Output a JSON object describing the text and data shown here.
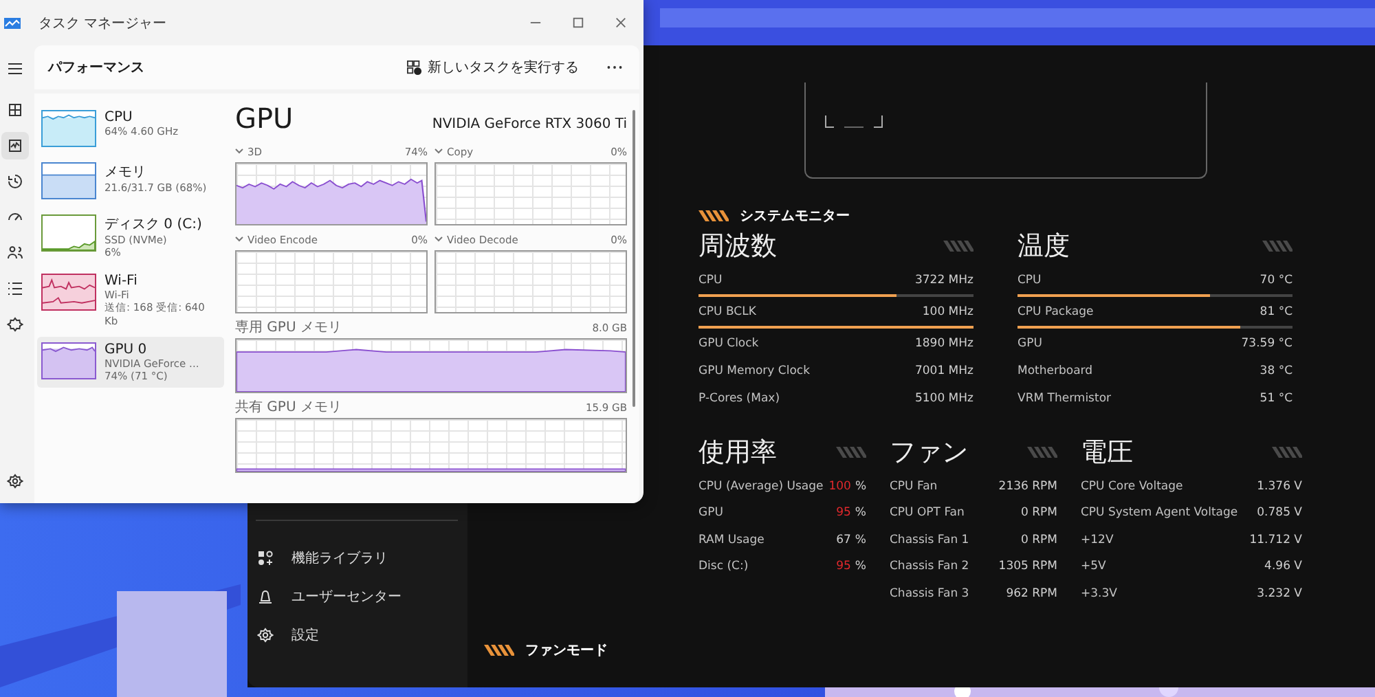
{
  "task_manager": {
    "title": "タスク マネージャー",
    "section": "パフォーマンス",
    "run_task": "新しいタスクを実行する",
    "rail": [
      {
        "kind": "processes",
        "selected": false
      },
      {
        "kind": "performance",
        "selected": true
      },
      {
        "kind": "history",
        "selected": false
      },
      {
        "kind": "startup",
        "selected": false
      },
      {
        "kind": "users",
        "selected": false
      },
      {
        "kind": "details",
        "selected": false
      },
      {
        "kind": "services",
        "selected": false
      }
    ],
    "devices": [
      {
        "kind": "cpu",
        "name": "CPU",
        "lines": [
          "64%  4.60 GHz"
        ],
        "selected": false
      },
      {
        "kind": "memory",
        "name": "メモリ",
        "lines": [
          "21.6/31.7 GB (68%)"
        ],
        "selected": false
      },
      {
        "kind": "disk",
        "name": "ディスク 0 (C:)",
        "lines": [
          "SSD (NVMe)",
          "6%"
        ],
        "selected": false
      },
      {
        "kind": "wifi",
        "name": "Wi-Fi",
        "lines": [
          "Wi-Fi",
          "送信: 168 受信: 640 Kb"
        ],
        "selected": false
      },
      {
        "kind": "gpu",
        "name": "GPU 0",
        "lines": [
          "NVIDIA GeForce ...",
          "74% (71 °C)"
        ],
        "selected": true
      }
    ],
    "detail": {
      "title": "GPU",
      "model": "NVIDIA GeForce RTX 3060 Ti",
      "engines": [
        {
          "name": "3D",
          "value": "74%",
          "kind": "busy"
        },
        {
          "name": "Copy",
          "value": "0%",
          "kind": "idle"
        },
        {
          "name": "Video Encode",
          "value": "0%",
          "kind": "idle"
        },
        {
          "name": "Video Decode",
          "value": "0%",
          "kind": "idle"
        }
      ],
      "memory": [
        {
          "name": "専用 GPU メモリ",
          "value": "8.0 GB",
          "kind": "high"
        },
        {
          "name": "共有 GPU メモリ",
          "value": "15.9 GB",
          "kind": "low"
        }
      ]
    }
  },
  "app": {
    "nav": [
      {
        "kind": "library",
        "label": "機能ライブラリ"
      },
      {
        "kind": "user",
        "label": "ユーザーセンター"
      },
      {
        "kind": "settings",
        "label": "設定"
      }
    ],
    "monitor_title": "システムモニター",
    "top_groups": [
      {
        "title": "周波数",
        "rows": [
          {
            "label": "CPU",
            "value": "3722 MHz",
            "level": 0.72
          },
          {
            "label": "CPU BCLK",
            "value": "100 MHz",
            "level": 1.0
          },
          {
            "label": "GPU Clock",
            "value": "1890 MHz"
          },
          {
            "label": "GPU Memory Clock",
            "value": "7001 MHz"
          },
          {
            "label": "P-Cores (Max)",
            "value": "5100 MHz"
          }
        ]
      },
      {
        "title": "温度",
        "rows": [
          {
            "label": "CPU",
            "value": "70 °C",
            "level": 0.7
          },
          {
            "label": "CPU Package",
            "value": "81 °C",
            "level": 0.81
          },
          {
            "label": "GPU",
            "value": "73.59 °C"
          },
          {
            "label": "Motherboard",
            "value": "38 °C"
          },
          {
            "label": "VRM Thermistor",
            "value": "51 °C"
          }
        ]
      }
    ],
    "bottom_groups": [
      {
        "title": "使用率",
        "rows": [
          {
            "label": "CPU (Average) Usage",
            "value": "100",
            "unit": "%",
            "alert": true
          },
          {
            "label": "GPU",
            "value": "95",
            "unit": "%",
            "alert": true
          },
          {
            "label": "RAM Usage",
            "value": "67",
            "unit": "%",
            "alert": false
          },
          {
            "label": "Disc (C:)",
            "value": "95",
            "unit": "%",
            "alert": true
          }
        ]
      },
      {
        "title": "ファン",
        "rows": [
          {
            "label": "CPU Fan",
            "value": "2136 RPM"
          },
          {
            "label": "CPU OPT Fan",
            "value": "0 RPM"
          },
          {
            "label": "Chassis Fan 1",
            "value": "0 RPM"
          },
          {
            "label": "Chassis Fan 2",
            "value": "1305 RPM"
          },
          {
            "label": "Chassis Fan 3",
            "value": "962 RPM"
          }
        ]
      },
      {
        "title": "電圧",
        "rows": [
          {
            "label": "CPU Core Voltage",
            "value": "1.376 V"
          },
          {
            "label": "CPU System Agent Voltage",
            "value": "0.785 V"
          },
          {
            "label": "+12V",
            "value": "11.712 V"
          },
          {
            "label": "+5V",
            "value": "4.96 V"
          },
          {
            "label": "+3.3V",
            "value": "3.232 V"
          }
        ]
      }
    ],
    "fan_mode": "ファンモード"
  }
}
